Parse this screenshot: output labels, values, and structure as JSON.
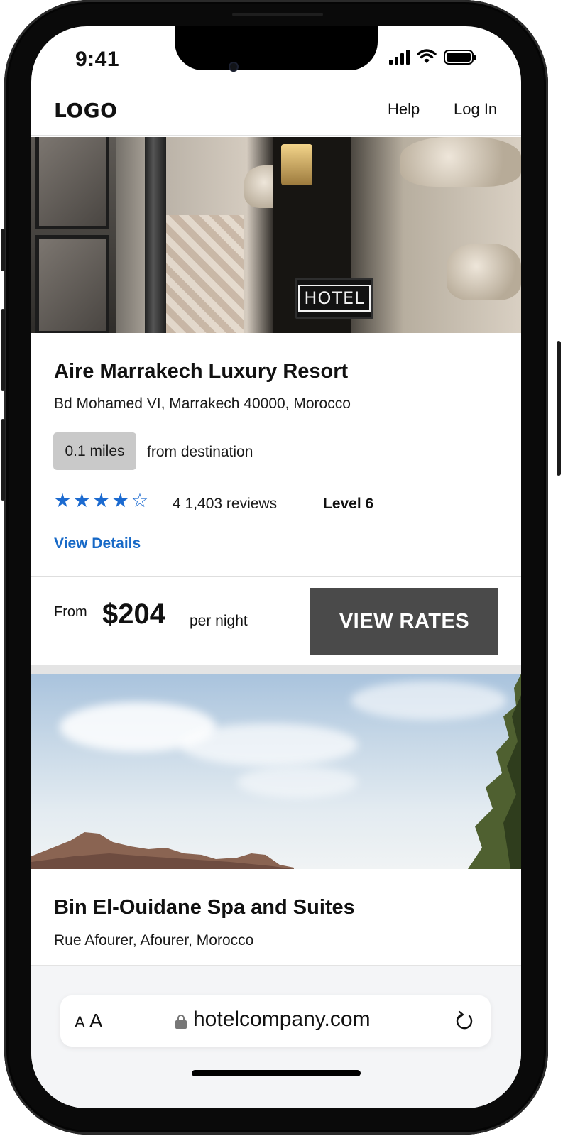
{
  "status_bar": {
    "time": "9:41"
  },
  "header": {
    "logo": "LOGO",
    "help_label": "Help",
    "login_label": "Log In"
  },
  "hotels": [
    {
      "image_sign": "HOTEL",
      "name": "Aire Marrakech Luxury Resort",
      "address": "Bd Mohamed VI, Marrakech 40000, Morocco",
      "distance": "0.1 miles",
      "distance_suffix": "from destination",
      "rating": 4,
      "rating_max": 5,
      "reviews": "4 1,403 reviews",
      "level": "Level 6",
      "details_link": "View Details",
      "price_prefix": "From",
      "price": "$204",
      "price_suffix": "per night",
      "cta_label": "VIEW RATES"
    },
    {
      "name": "Bin El-Ouidane Spa and Suites",
      "address": "Rue Afourer, Afourer, Morocco"
    }
  ],
  "browser": {
    "text_size_label": "AA",
    "url": "hotelcompany.com"
  },
  "icons": {
    "signal": "cellular-signal-icon",
    "wifi": "wifi-icon",
    "battery": "battery-icon",
    "star": "star-icon",
    "lock": "lock-icon",
    "reload": "reload-icon"
  },
  "colors": {
    "accent_link": "#1769c7",
    "star": "#1b6ad0",
    "cta_background": "#4a4a4a",
    "badge_background": "#c9c9c9"
  }
}
